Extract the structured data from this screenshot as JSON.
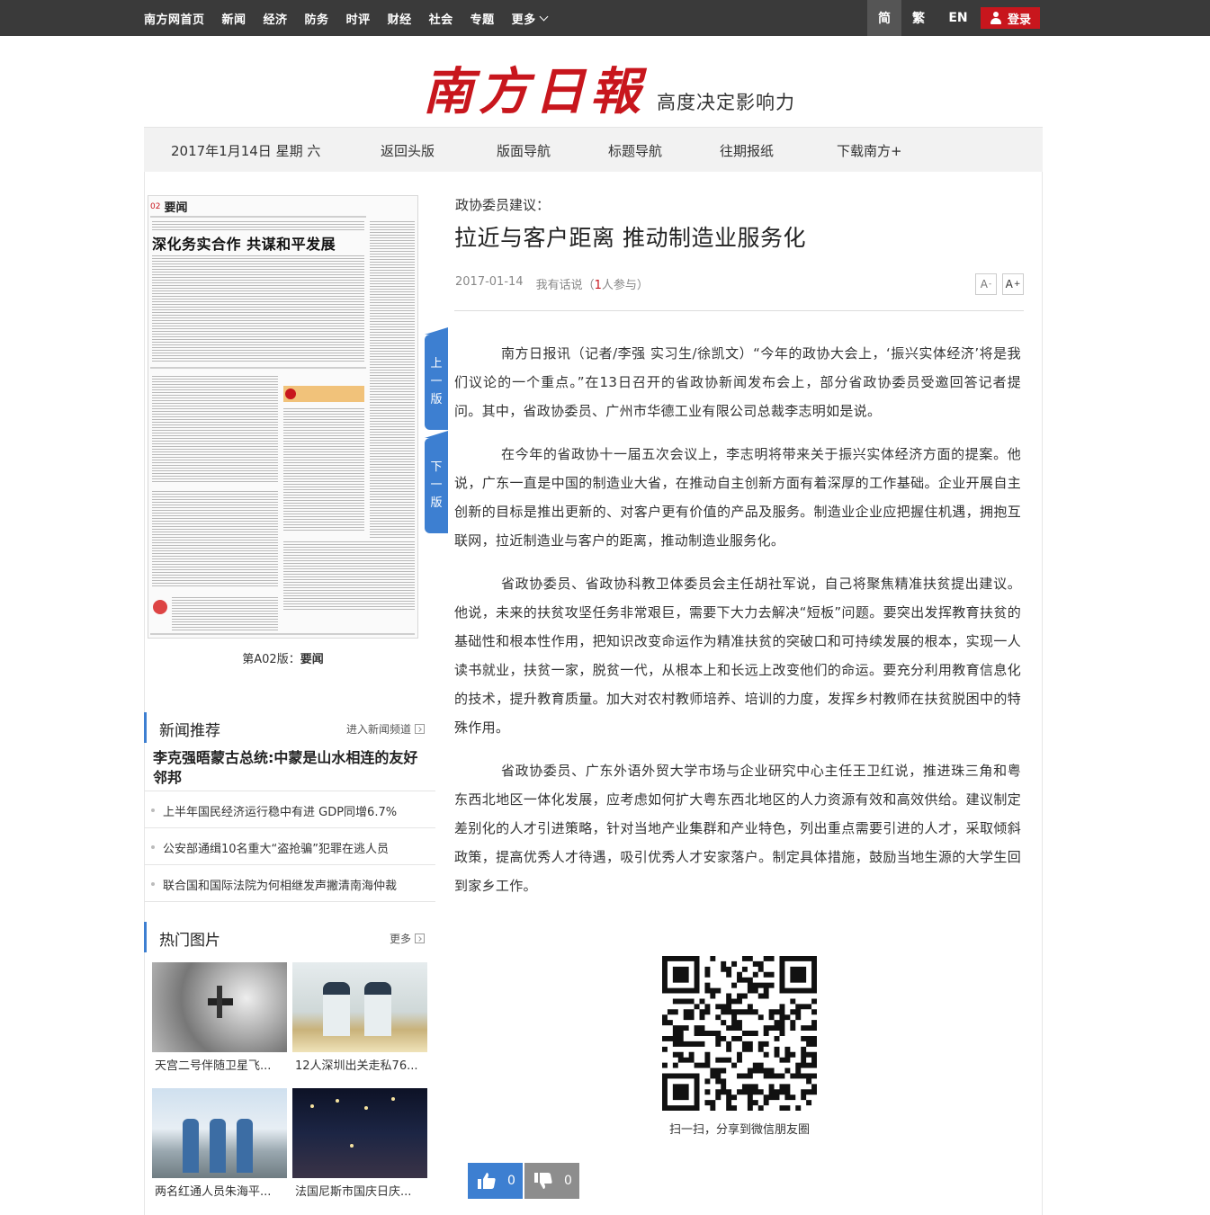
{
  "topnav": {
    "items": [
      "南方网首页",
      "新闻",
      "经济",
      "防务",
      "时评",
      "财经",
      "社会",
      "专题"
    ],
    "more": "更多",
    "langs": [
      "简",
      "繁",
      "EN"
    ],
    "login": "登录"
  },
  "masthead": {
    "logo": "南方日報",
    "slogan": "高度决定影响力"
  },
  "mainnav": {
    "date": "2017年1月14日 星期 六",
    "items": [
      "返回头版",
      "版面导航",
      "标题导航",
      "往期报纸",
      "下载南方+"
    ]
  },
  "paper": {
    "page_num": "02",
    "page_label": "要闻",
    "headline": "深化务实合作 共谋和平发展",
    "caption_prefix": "第A02版：",
    "caption_name": "要闻"
  },
  "page_buttons": {
    "prev": [
      "上",
      "一",
      "版"
    ],
    "next": [
      "下",
      "一",
      "版"
    ]
  },
  "news": {
    "section_title": "新闻推荐",
    "more": "进入新闻频道",
    "lead": "李克强晤蒙古总统:中蒙是山水相连的友好邻邦",
    "items": [
      "上半年国民经济运行稳中有进 GDP同增6.7%",
      "公安部通缉10名重大“盗抢骗”犯罪在逃人员",
      "联合国和国际法院为何相继发声撇清南海仲裁"
    ]
  },
  "photos": {
    "section_title": "热门图片",
    "more": "更多",
    "items": [
      {
        "caption": "天宫二号伴随卫星飞...",
        "icon": "space-station-image"
      },
      {
        "caption": "12人深圳出关走私76...",
        "icon": "customs-image"
      },
      {
        "caption": "两名红通人员朱海平...",
        "icon": "airport-image"
      },
      {
        "caption": "法国尼斯市国庆日庆...",
        "icon": "night-street-image"
      }
    ]
  },
  "article": {
    "kicker": "政协委员建议：",
    "title": "拉近与客户距离 推动制造业服务化",
    "date": "2017-01-14",
    "comment_prefix": "我有话说（",
    "comment_count": "1",
    "comment_suffix": "人参与）",
    "font_smaller": "A",
    "font_larger": "A",
    "paragraphs": [
      "南方日报讯（记者/李强 实习生/徐凯文）“今年的政协大会上，‘振兴实体经济’将是我们议论的一个重点。”在13日召开的省政协新闻发布会上，部分省政协委员受邀回答记者提问。其中，省政协委员、广州市华德工业有限公司总裁李志明如是说。",
      "在今年的省政协十一届五次会议上，李志明将带来关于振兴实体经济方面的提案。他说，广东一直是中国的制造业大省，在推动自主创新方面有着深厚的工作基础。企业开展自主创新的目标是推出更新的、对客户更有价值的产品及服务。制造业企业应把握住机遇，拥抱互联网，拉近制造业与客户的距离，推动制造业服务化。",
      "省政协委员、省政协科教卫体委员会主任胡社军说，自己将聚焦精准扶贫提出建议。他说，未来的扶贫攻坚任务非常艰巨，需要下大力去解决“短板”问题。要突出发挥教育扶贫的基础性和根本性作用，把知识改变命运作为精准扶贫的突破口和可持续发展的根本，实现一人读书就业，扶贫一家，脱贫一代，从根本上和长远上改变他们的命运。要充分利用教育信息化的技术，提升教育质量。加大对农村教师培养、培训的力度，发挥乡村教师在扶贫脱困中的特殊作用。",
      "省政协委员、广东外语外贸大学市场与企业研究中心主任王卫红说，推进珠三角和粤东西北地区一体化发展，应考虑如何扩大粤东西北地区的人力资源有效和高效供给。建议制定差别化的人才引进策略，针对当地产业集群和产业特色，列出重点需要引进的人才，采取倾斜政策，提高优秀人才待遇，吸引优秀人才安家落户。制定具体措施，鼓励当地生源的大学生回到家乡工作。"
    ]
  },
  "share": {
    "qr_caption": "扫一扫，分享到微信朋友圈"
  },
  "votes": {
    "up_count": "0",
    "down_count": "0"
  },
  "colors": {
    "brand_red": "#c8161d",
    "accent_blue": "#3d7fd1",
    "topbar": "#3a3a3a"
  }
}
